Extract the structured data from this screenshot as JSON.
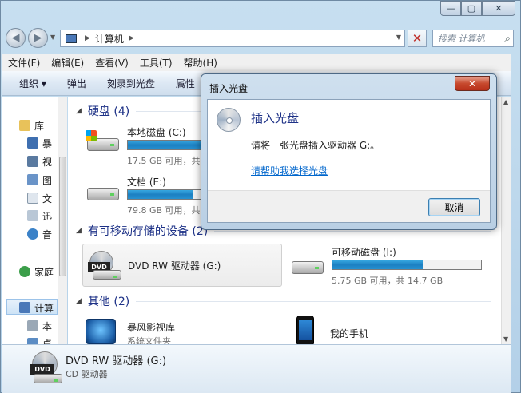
{
  "window": {
    "address_root": "计算机",
    "search_placeholder": "搜索 计算机"
  },
  "menubar": [
    "文件(F)",
    "编辑(E)",
    "查看(V)",
    "工具(T)",
    "帮助(H)"
  ],
  "commandbar": [
    "组织 ▾",
    "弹出",
    "刻录到光盘",
    "属性"
  ],
  "nav": {
    "library": "库",
    "library_items": [
      "暴",
      "视",
      "图",
      "文",
      "迅",
      "音"
    ],
    "homegroup": "家庭",
    "computer": "计算",
    "computer_items": [
      "本",
      "桌"
    ]
  },
  "groups": {
    "hdd": "硬盘 (4)",
    "removable": "有可移动存储的设备 (2)",
    "other": "其他 (2)"
  },
  "drives": {
    "c": {
      "name": "本地磁盘 (C:)",
      "info": "17.5 GB 可用，共",
      "used_fraction": 0.93
    },
    "e": {
      "name": "文档 (E:)",
      "info": "79.8 GB 可用，共",
      "used_fraction": 0.44
    },
    "g": {
      "name": "DVD RW 驱动器 (G:)",
      "label": "DVD"
    },
    "i": {
      "name": "可移动磁盘 (I:)",
      "info": "5.75 GB 可用，共 14.7 GB",
      "used_fraction": 0.61
    }
  },
  "other_items": {
    "baofeng_name": "暴风影视库",
    "baofeng_type": "系统文件夹",
    "phone_name": "我的手机"
  },
  "details": {
    "name": "DVD RW 驱动器 (G:)",
    "type": "CD 驱动器",
    "label": "DVD"
  },
  "dialog": {
    "title": "插入光盘",
    "heading": "插入光盘",
    "message": "请将一张光盘插入驱动器 G:。",
    "link": "请帮助我选择光盘",
    "cancel": "取消"
  },
  "colors": {
    "accent_blue": "#1e3287",
    "link": "#0066cc",
    "bar_fill": "#1c80c2"
  }
}
